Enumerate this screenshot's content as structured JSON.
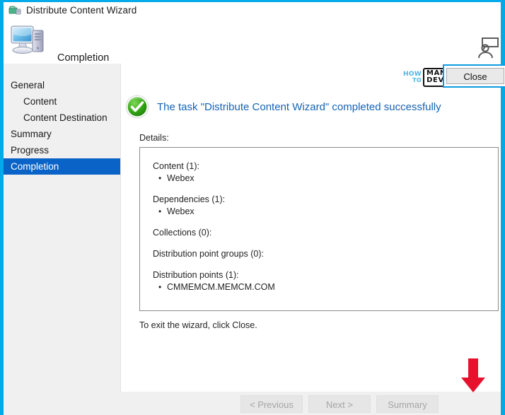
{
  "window": {
    "title": "Distribute Content Wizard",
    "title_icon": "distribute-content-icon",
    "accent_color": "#00a9e9"
  },
  "header": {
    "icon": "computer-icon",
    "title": "Completion",
    "right_icon": "user-presenter-icon"
  },
  "sidebar": {
    "items": [
      {
        "label": "General",
        "indent": false,
        "selected": false
      },
      {
        "label": "Content",
        "indent": true,
        "selected": false
      },
      {
        "label": "Content Destination",
        "indent": true,
        "selected": false
      },
      {
        "label": "Summary",
        "indent": false,
        "selected": false
      },
      {
        "label": "Progress",
        "indent": false,
        "selected": false
      },
      {
        "label": "Completion",
        "indent": false,
        "selected": true
      }
    ],
    "selected_color": "#0a64c8"
  },
  "brand": {
    "how": "HOW",
    "to": "TO",
    "manage": "MANAGE",
    "devices": "DEVICES",
    "how_to_color": "#4ab6e8"
  },
  "main": {
    "status_icon": "green-check-circle-icon",
    "status_text": "The task \"Distribute Content Wizard\" completed successfully",
    "status_color": "#1563b6",
    "details_label": "Details:",
    "details": [
      {
        "heading": "Content (1):",
        "items": [
          "Webex"
        ]
      },
      {
        "heading": "Dependencies (1):",
        "items": [
          "Webex"
        ]
      },
      {
        "heading": "Collections (0):",
        "items": []
      },
      {
        "heading": "Distribution point groups (0):",
        "items": []
      },
      {
        "heading": "Distribution points (1):",
        "items": [
          "CMMEMCM.MEMCM.COM"
        ]
      }
    ],
    "exit_note": "To exit the wizard, click Close."
  },
  "footer": {
    "previous_label": "< Previous",
    "next_label": "Next >",
    "summary_label": "Summary",
    "close_label": "Close"
  },
  "annotation": {
    "arrow": "red-down-arrow",
    "arrow_color": "#e8112d"
  }
}
